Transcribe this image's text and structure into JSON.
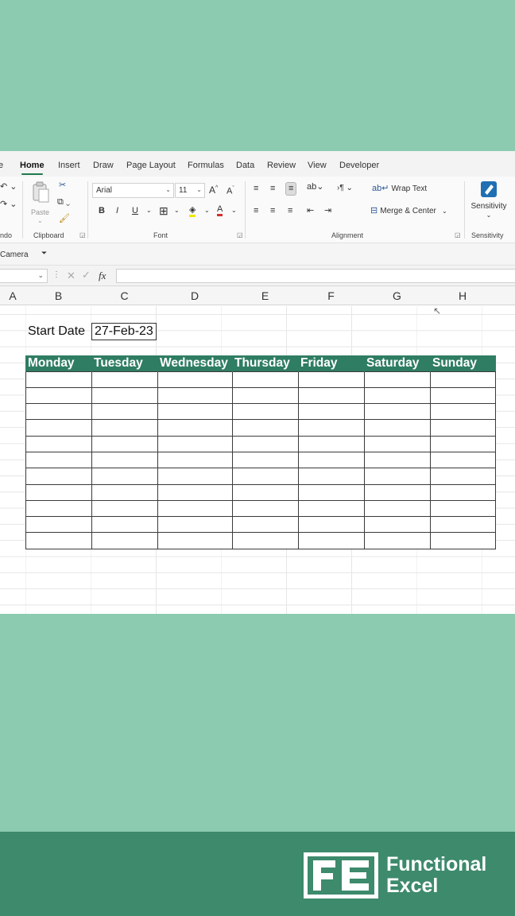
{
  "ribbon": {
    "tabs": [
      "e",
      "Home",
      "Insert",
      "Draw",
      "Page Layout",
      "Formulas",
      "Data",
      "Review",
      "View",
      "Developer"
    ],
    "active_tab": "Home",
    "groups": {
      "undo_label": "ndo",
      "clipboard_label": "Clipboard",
      "paste_label": "Paste",
      "font_label": "Font",
      "alignment_label": "Alignment",
      "sensitivity_label": "Sensitivity",
      "sensitivity_button": "Sensitivity"
    },
    "font_name": "Arial",
    "font_size": "11",
    "wrap_text": "Wrap Text",
    "merge_center": "Merge & Center",
    "accent_color": "#1e7a4c"
  },
  "quick_access": {
    "camera": "Camera"
  },
  "formula_bar": {
    "fx": "fx",
    "value": ""
  },
  "columns": [
    "A",
    "B",
    "C",
    "D",
    "E",
    "F",
    "G",
    "H"
  ],
  "sheet": {
    "start_date_label": "Start Date",
    "start_date_value": "27-Feb-23",
    "weekdays": [
      "Monday",
      "Tuesday",
      "Wednesday",
      "Thursday",
      "Friday",
      "Saturday",
      "Sunday"
    ],
    "header_color": "#2f7d62",
    "empty_rows": 11
  },
  "footer": {
    "brand_line1": "Functional",
    "brand_line2": "Excel",
    "logo_letters": "FE"
  }
}
